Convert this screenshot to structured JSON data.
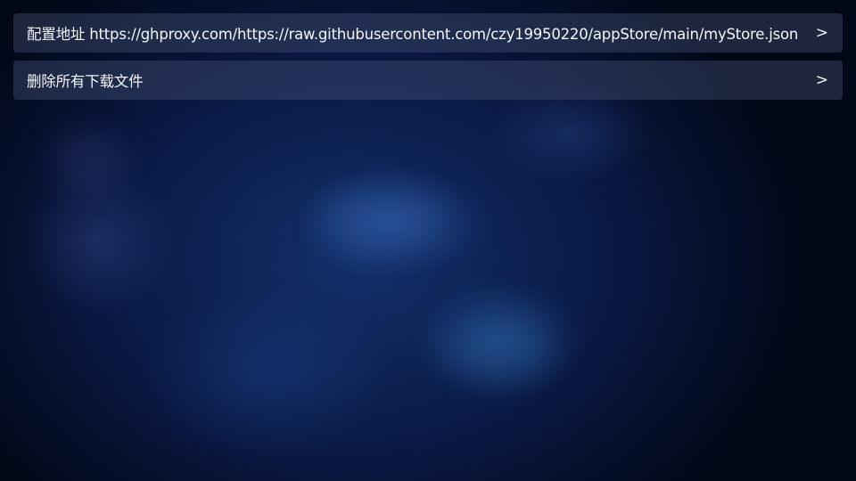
{
  "settings": {
    "items": [
      {
        "label": "配置地址 https://ghproxy.com/https://raw.githubusercontent.com/czy19950220/appStore/main/myStore.json",
        "arrow": ">"
      },
      {
        "label": "删除所有下载文件",
        "arrow": ">"
      }
    ]
  },
  "colors": {
    "background": "#0a1a45",
    "row_background": "#3f4a66",
    "text": "#f4f6fb"
  }
}
